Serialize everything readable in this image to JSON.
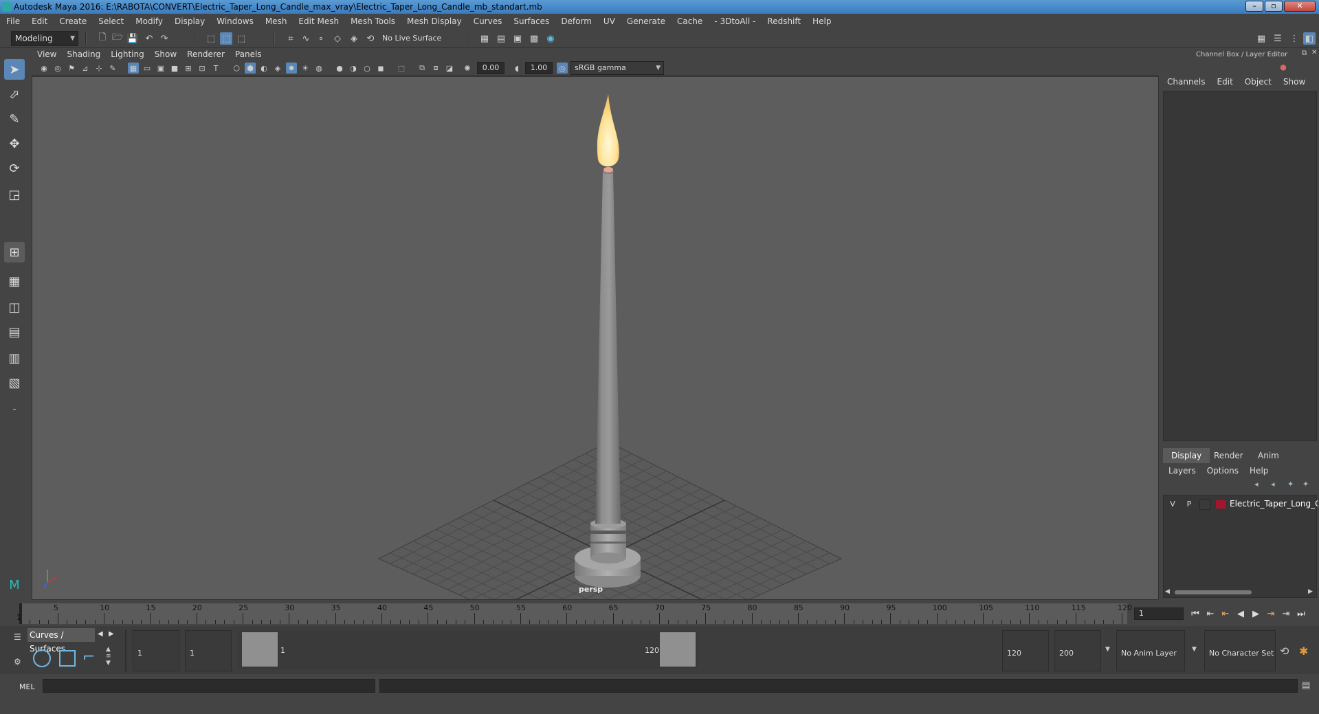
{
  "window": {
    "title": "Autodesk Maya 2016: E:\\RABOTA\\CONVERT\\Electric_Taper_Long_Candle_max_vray\\Electric_Taper_Long_Candle_mb_standart.mb"
  },
  "menubar": [
    "File",
    "Edit",
    "Create",
    "Select",
    "Modify",
    "Display",
    "Windows",
    "Mesh",
    "Edit Mesh",
    "Mesh Tools",
    "Mesh Display",
    "Curves",
    "Surfaces",
    "Deform",
    "UV",
    "Generate",
    "Cache",
    "- 3DtoAll -",
    "Redshift",
    "Help"
  ],
  "statusline": {
    "mode": "Modeling",
    "live_surface": "No Live Surface"
  },
  "viewport": {
    "menu": [
      "View",
      "Shading",
      "Lighting",
      "Show",
      "Renderer",
      "Panels"
    ],
    "exposure": "0.00",
    "gamma": "1.00",
    "color_space": "sRGB gamma",
    "camera_label": "persp"
  },
  "right_panel": {
    "header": "Channel Box / Layer Editor",
    "channel_tabs": [
      "Channels",
      "Edit",
      "Object",
      "Show"
    ],
    "layer_tabs": [
      "Display",
      "Render",
      "Anim"
    ],
    "layer_menu": [
      "Layers",
      "Options",
      "Help"
    ],
    "layers": [
      {
        "v": "V",
        "p": "P",
        "name": "Electric_Taper_Long_Can",
        "color": "#a51530"
      }
    ]
  },
  "timeline": {
    "ticks": [
      "1",
      "5",
      "10",
      "15",
      "20",
      "25",
      "30",
      "35",
      "40",
      "45",
      "50",
      "55",
      "60",
      "65",
      "70",
      "75",
      "80",
      "85",
      "90",
      "95",
      "100",
      "105",
      "110",
      "115",
      "120"
    ],
    "current_frame": "1"
  },
  "range": {
    "shelf_tab": "Curves / Surfaces",
    "start_frame": "1",
    "playback_start": "1",
    "range_start_label": "1",
    "range_end_label": "120",
    "playback_end": "120",
    "end_frame": "200",
    "anim_layer": "No Anim Layer",
    "character_set": "No Character Set"
  },
  "command_line": {
    "label": "MEL"
  },
  "colors": {
    "accent": "#5a87b5",
    "viewport_bg": "#5d5d5d",
    "layer_color": "#a51530"
  }
}
